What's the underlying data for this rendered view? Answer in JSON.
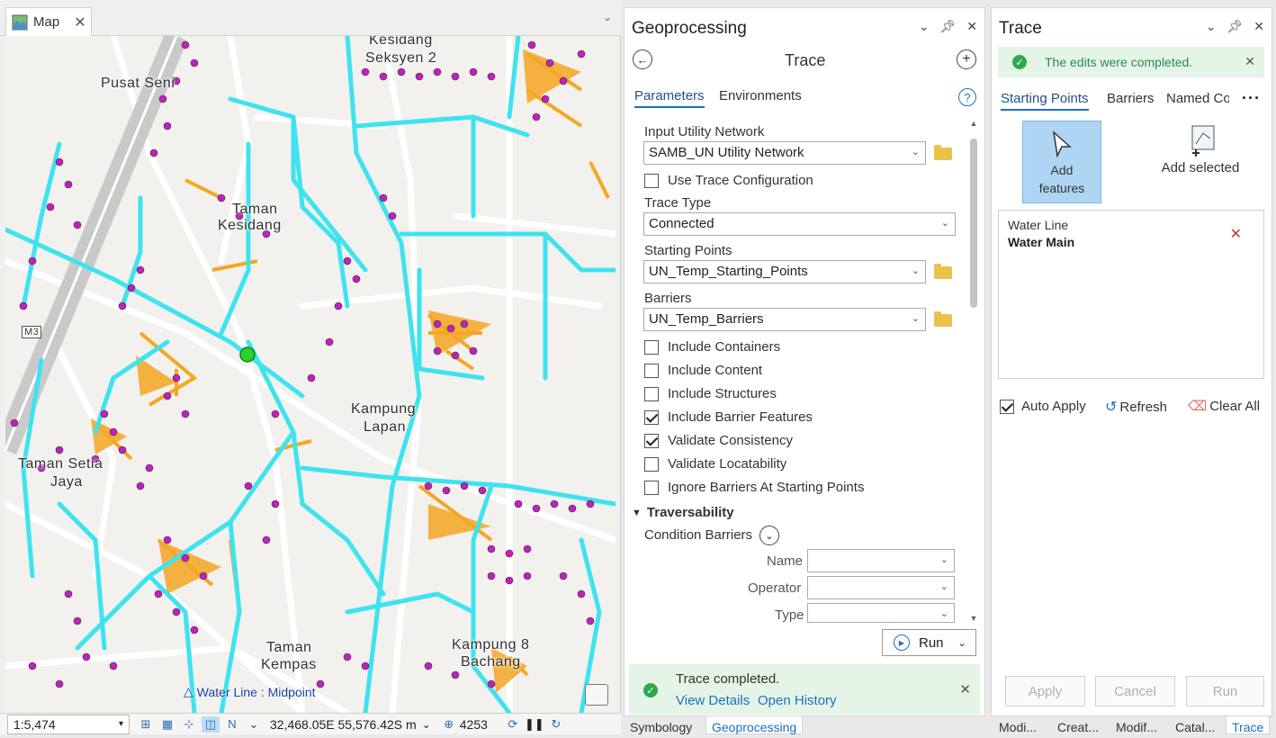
{
  "map": {
    "tab_label": "Map",
    "scale": "1:5,474",
    "coordinates": "32,468.05E 55,576.42S m",
    "selected_count": "4253",
    "snap_hint": "Water Line : Midpoint",
    "place_labels": [
      {
        "text": "Kesidang",
        "id": "kesidang"
      },
      {
        "text": "Seksyen 2",
        "id": "seksyen2"
      },
      {
        "text": "Pusat Seni",
        "id": "pusat"
      },
      {
        "text": "Taman",
        "id": "taman1"
      },
      {
        "text": "Kesidang",
        "id": "kesidang2"
      },
      {
        "text": "Kampung",
        "id": "kampung"
      },
      {
        "text": "Lapan",
        "id": "lapan"
      },
      {
        "text": "Taman Setia",
        "id": "setia"
      },
      {
        "text": "Jaya",
        "id": "jaya"
      },
      {
        "text": "Taman",
        "id": "taman2"
      },
      {
        "text": "Kempas",
        "id": "kempas"
      },
      {
        "text": "Kampung 8",
        "id": "kampung8"
      },
      {
        "text": "Bachang",
        "id": "bachang"
      },
      {
        "text": "M3",
        "id": "m3"
      }
    ]
  },
  "geoprocessing": {
    "title": "Geoprocessing",
    "tool_title": "Trace",
    "tabs": [
      "Parameters",
      "Environments"
    ],
    "input_network_label": "Input Utility Network",
    "input_network_value": "SAMB_UN Utility Network",
    "use_trace_config_label": "Use Trace Configuration",
    "trace_type_label": "Trace Type",
    "trace_type_value": "Connected",
    "starting_points_label": "Starting Points",
    "starting_points_value": "UN_Temp_Starting_Points",
    "barriers_label": "Barriers",
    "barriers_value": "UN_Temp_Barriers",
    "checkboxes": [
      {
        "label": "Include Containers",
        "checked": false
      },
      {
        "label": "Include Content",
        "checked": false
      },
      {
        "label": "Include Structures",
        "checked": false
      },
      {
        "label": "Include Barrier Features",
        "checked": true
      },
      {
        "label": "Validate Consistency",
        "checked": true
      },
      {
        "label": "Validate Locatability",
        "checked": false
      },
      {
        "label": "Ignore Barriers At Starting Points",
        "checked": false
      }
    ],
    "traversability_label": "Traversability",
    "condition_barriers_label": "Condition Barriers",
    "name_label": "Name",
    "operator_label": "Operator",
    "type_label": "Type",
    "run_label": "Run",
    "status_title": "Trace completed.",
    "view_details": "View Details",
    "open_history": "Open History"
  },
  "trace": {
    "title": "Trace",
    "notice": "The edits were completed.",
    "tabs": [
      "Starting Points",
      "Barriers",
      "Named Co"
    ],
    "add_features_label": "Add features",
    "add_selected_label": "Add selected",
    "item_line1": "Water Line",
    "item_line2": "Water Main",
    "auto_apply_label": "Auto Apply",
    "refresh_label": "Refresh",
    "clear_all_label": "Clear All",
    "apply_label": "Apply",
    "cancel_label": "Cancel",
    "run_label": "Run"
  },
  "bottom_tabs": {
    "left": [
      "Symbology",
      "Geoprocessing"
    ],
    "right": [
      "Modi...",
      "Creat...",
      "Modif...",
      "Catal...",
      "Trace"
    ]
  },
  "colors": {
    "network_line": "#3ee3ee",
    "service_line": "#f5a623",
    "meter_point": "#c21fbf",
    "accent": "#1d6fbf",
    "success": "#2fa84f"
  }
}
